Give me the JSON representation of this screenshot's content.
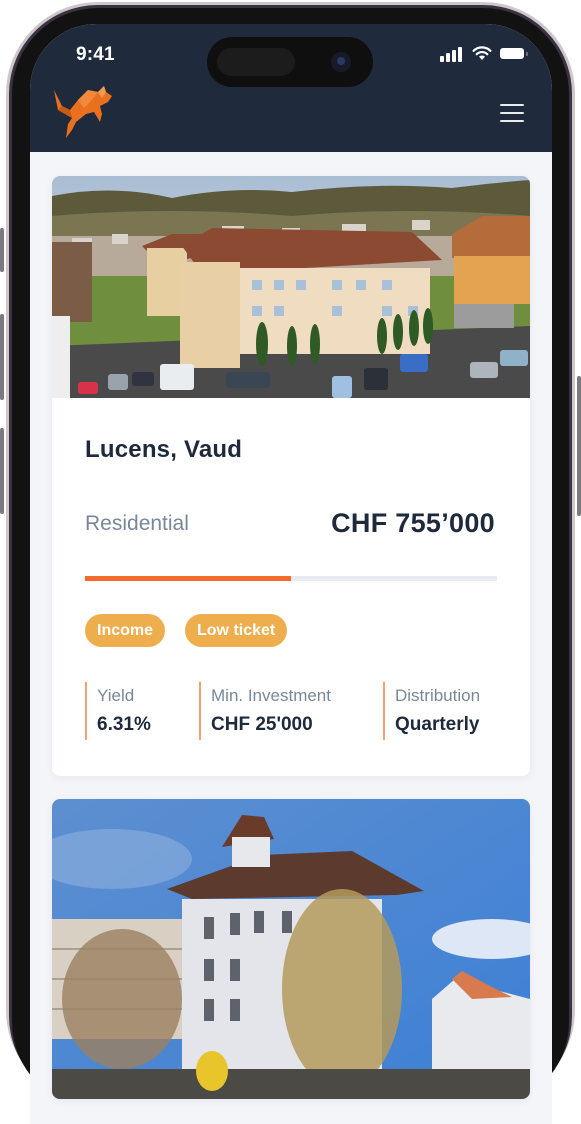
{
  "status_bar": {
    "time": "9:41",
    "icons": [
      "cellular-signal-icon",
      "wifi-icon",
      "battery-icon"
    ]
  },
  "header": {
    "logo": "orange-fox-logo",
    "menu_icon": "hamburger-menu-icon"
  },
  "colors": {
    "header_bg": "#1f2a3c",
    "page_bg": "#f3f5f9",
    "accent_orange": "#f36a2a",
    "tag_bg": "#efae4e",
    "text_dark": "#1e2a3b",
    "text_muted": "#7a8798"
  },
  "listings": [
    {
      "image": "aerial photo of a beige apartment building with brown tiled roof, parking lot and hillside village",
      "title": "Lucens, Vaud",
      "category": "Residential",
      "price": "CHF 755’000",
      "funded_fraction": 0.5,
      "tags": [
        "Income",
        "Low ticket"
      ],
      "stats": [
        {
          "label": "Yield",
          "value": "6.31%"
        },
        {
          "label": "Min. Investment",
          "value": "CHF 25'000"
        },
        {
          "label": "Distribution",
          "value": "Quarterly"
        }
      ]
    },
    {
      "image": "white three-story house with brown roof and weeping willow under blue sky"
    }
  ]
}
